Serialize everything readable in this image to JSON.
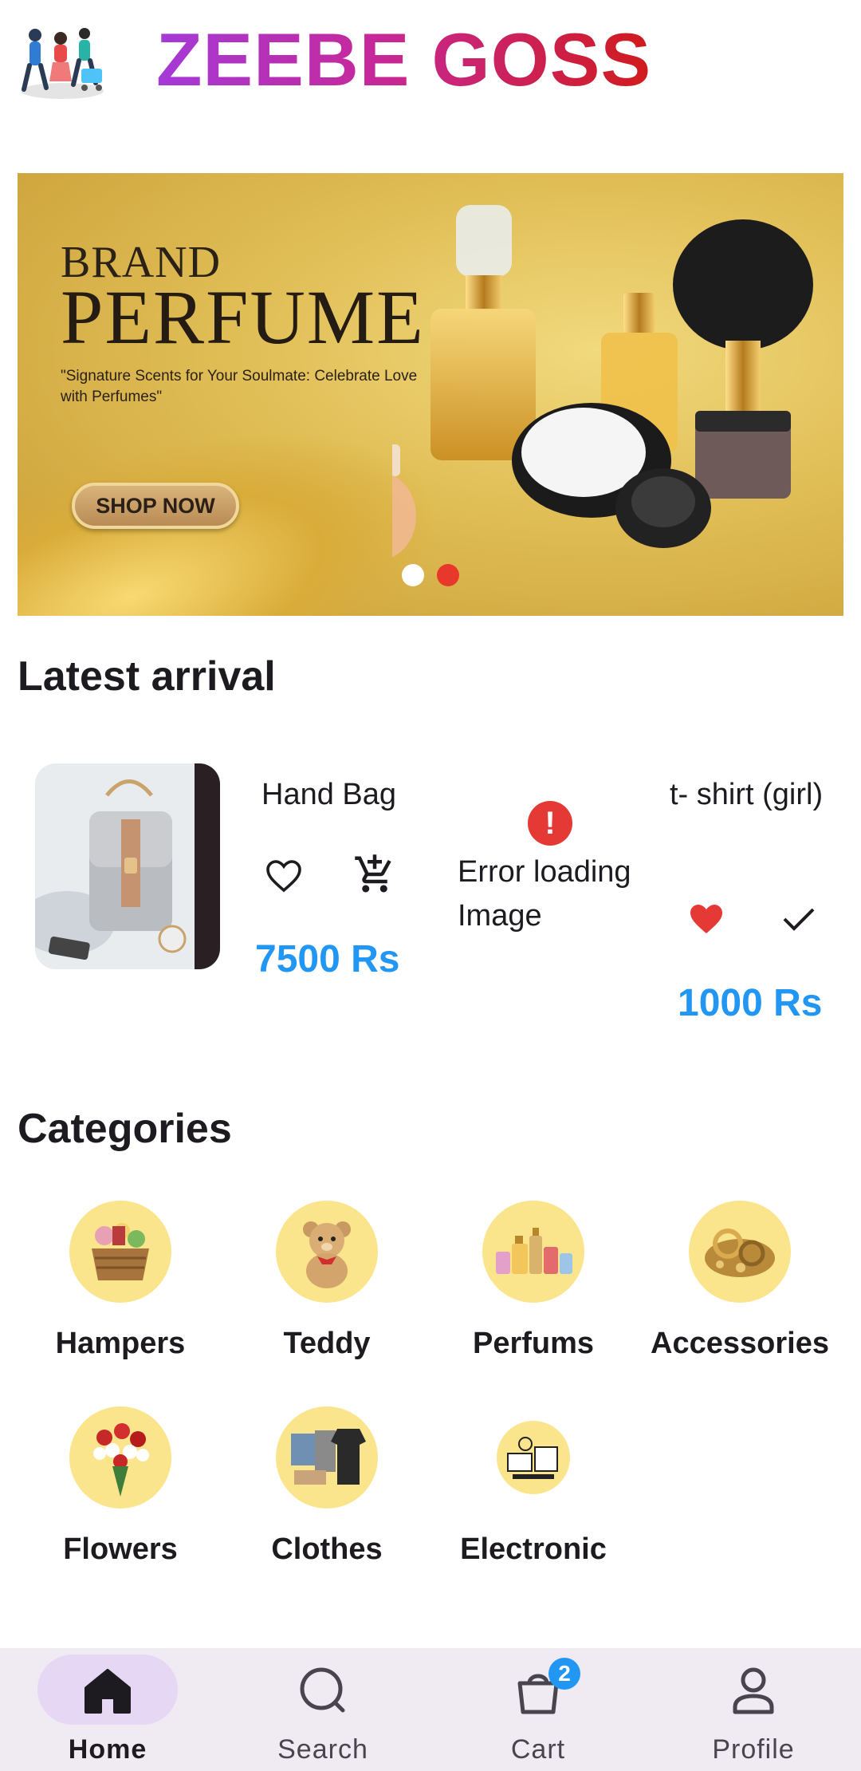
{
  "header": {
    "app_title": "ZEEBE GOSS"
  },
  "banner": {
    "brand": "BRAND",
    "headline": "PERFUME",
    "tagline": "\"Signature Scents for Your Soulmate: Celebrate Love with Perfumes\"",
    "cta_label": "SHOP NOW",
    "slide_count": 2,
    "active_slide": 2
  },
  "latest": {
    "title": "Latest arrival",
    "products": [
      {
        "name": "Hand Bag",
        "price": "7500 Rs",
        "favorite": false,
        "in_cart": false,
        "image": "handbag"
      },
      {
        "name": "t- shirt (girl)",
        "price": "1000 Rs",
        "favorite": true,
        "in_cart": true,
        "image": "error"
      }
    ],
    "error_text": "Error loading Image"
  },
  "categories": {
    "title": "Categories",
    "items": [
      {
        "label": "Hampers"
      },
      {
        "label": "Teddy"
      },
      {
        "label": "Perfums"
      },
      {
        "label": "Accessories"
      },
      {
        "label": "Flowers"
      },
      {
        "label": "Clothes"
      },
      {
        "label": "Electronic"
      }
    ]
  },
  "nav": {
    "items": [
      {
        "label": "Home",
        "icon": "home-icon",
        "active": true
      },
      {
        "label": "Search",
        "icon": "search-icon",
        "active": false
      },
      {
        "label": "Cart",
        "icon": "cart-icon",
        "active": false,
        "badge": "2"
      },
      {
        "label": "Profile",
        "icon": "profile-icon",
        "active": false
      }
    ]
  },
  "colors": {
    "price": "#2196f3",
    "favorite": "#e53935",
    "category_circle": "#fbe58c",
    "nav_bg": "#f0eaf3",
    "nav_active_pill": "#e6d7f4"
  }
}
